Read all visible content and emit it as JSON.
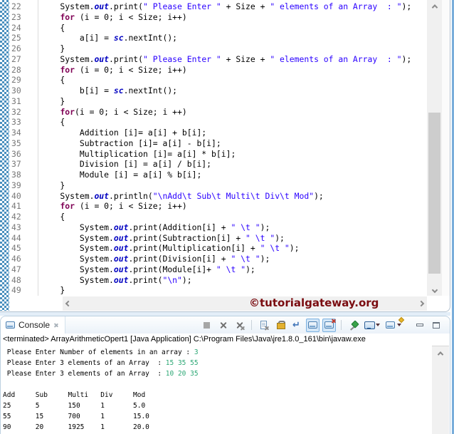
{
  "editor": {
    "line_numbers": [
      "22",
      "23",
      "24",
      "25",
      "26",
      "27",
      "28",
      "29",
      "30",
      "31",
      "32",
      "33",
      "34",
      "35",
      "36",
      "37",
      "38",
      "39",
      "40",
      "41",
      "42",
      "43",
      "44",
      "45",
      "46",
      "47",
      "48",
      "49"
    ],
    "code_lines": [
      {
        "segments": [
          {
            "t": "    System.",
            "c": "p"
          },
          {
            "t": "out",
            "c": "f"
          },
          {
            "t": ".print(",
            "c": "p"
          },
          {
            "t": "\" Please Enter \"",
            "c": "s"
          },
          {
            "t": " + Size + ",
            "c": "p"
          },
          {
            "t": "\" elements of an Array  : \"",
            "c": "s"
          },
          {
            "t": ");",
            "c": "p"
          }
        ]
      },
      {
        "segments": [
          {
            "t": "    ",
            "c": "p"
          },
          {
            "t": "for",
            "c": "k"
          },
          {
            "t": " (i = 0; i < Size; i++)",
            "c": "p"
          }
        ]
      },
      {
        "segments": [
          {
            "t": "    {",
            "c": "p"
          }
        ]
      },
      {
        "segments": [
          {
            "t": "        a[i] = ",
            "c": "p"
          },
          {
            "t": "sc",
            "c": "f"
          },
          {
            "t": ".nextInt();",
            "c": "p"
          }
        ]
      },
      {
        "segments": [
          {
            "t": "    }",
            "c": "p"
          }
        ]
      },
      {
        "segments": [
          {
            "t": "    System.",
            "c": "p"
          },
          {
            "t": "out",
            "c": "f"
          },
          {
            "t": ".print(",
            "c": "p"
          },
          {
            "t": "\" Please Enter \"",
            "c": "s"
          },
          {
            "t": " + Size + ",
            "c": "p"
          },
          {
            "t": "\" elements of an Array  : \"",
            "c": "s"
          },
          {
            "t": ");",
            "c": "p"
          }
        ]
      },
      {
        "segments": [
          {
            "t": "    ",
            "c": "p"
          },
          {
            "t": "for",
            "c": "k"
          },
          {
            "t": " (i = 0; i < Size; i++)",
            "c": "p"
          }
        ]
      },
      {
        "segments": [
          {
            "t": "    {",
            "c": "p"
          }
        ]
      },
      {
        "segments": [
          {
            "t": "        b[i] = ",
            "c": "p"
          },
          {
            "t": "sc",
            "c": "f"
          },
          {
            "t": ".nextInt();",
            "c": "p"
          }
        ]
      },
      {
        "segments": [
          {
            "t": "    }",
            "c": "p"
          }
        ]
      },
      {
        "segments": [
          {
            "t": "    ",
            "c": "p"
          },
          {
            "t": "for",
            "c": "k"
          },
          {
            "t": "(i = 0; i < Size; i ++)",
            "c": "p"
          }
        ]
      },
      {
        "segments": [
          {
            "t": "    {",
            "c": "p"
          }
        ]
      },
      {
        "segments": [
          {
            "t": "        Addition [i]= a[i] + b[i];",
            "c": "p"
          }
        ]
      },
      {
        "segments": [
          {
            "t": "        Subtraction [i]= a[i] - b[i];",
            "c": "p"
          }
        ]
      },
      {
        "segments": [
          {
            "t": "        Multiplication [i]= a[i] * b[i];",
            "c": "p"
          }
        ]
      },
      {
        "segments": [
          {
            "t": "        Division [i] = a[i] / b[i];",
            "c": "p"
          }
        ]
      },
      {
        "segments": [
          {
            "t": "        Module [i] = a[i] % b[i];",
            "c": "p"
          }
        ]
      },
      {
        "segments": [
          {
            "t": "    }",
            "c": "p"
          }
        ]
      },
      {
        "segments": [
          {
            "t": "    System.",
            "c": "p"
          },
          {
            "t": "out",
            "c": "f"
          },
          {
            "t": ".println(",
            "c": "p"
          },
          {
            "t": "\"\\nAdd\\t Sub\\t Multi\\t Div\\t Mod\"",
            "c": "s"
          },
          {
            "t": ");",
            "c": "p"
          }
        ]
      },
      {
        "segments": [
          {
            "t": "    ",
            "c": "p"
          },
          {
            "t": "for",
            "c": "k"
          },
          {
            "t": " (i = 0; i < Size; i++)",
            "c": "p"
          }
        ]
      },
      {
        "segments": [
          {
            "t": "    {",
            "c": "p"
          }
        ]
      },
      {
        "segments": [
          {
            "t": "        System.",
            "c": "p"
          },
          {
            "t": "out",
            "c": "f"
          },
          {
            "t": ".print(Addition[i] + ",
            "c": "p"
          },
          {
            "t": "\" \\t \"",
            "c": "s"
          },
          {
            "t": ");",
            "c": "p"
          }
        ]
      },
      {
        "segments": [
          {
            "t": "        System.",
            "c": "p"
          },
          {
            "t": "out",
            "c": "f"
          },
          {
            "t": ".print(Subtraction[i] + ",
            "c": "p"
          },
          {
            "t": "\" \\t \"",
            "c": "s"
          },
          {
            "t": ");",
            "c": "p"
          }
        ]
      },
      {
        "segments": [
          {
            "t": "        System.",
            "c": "p"
          },
          {
            "t": "out",
            "c": "f"
          },
          {
            "t": ".print(Multiplication[i] + ",
            "c": "p"
          },
          {
            "t": "\" \\t \"",
            "c": "s"
          },
          {
            "t": ");",
            "c": "p"
          }
        ]
      },
      {
        "segments": [
          {
            "t": "        System.",
            "c": "p"
          },
          {
            "t": "out",
            "c": "f"
          },
          {
            "t": ".print(Division[i] + ",
            "c": "p"
          },
          {
            "t": "\" \\t \"",
            "c": "s"
          },
          {
            "t": ");",
            "c": "p"
          }
        ]
      },
      {
        "segments": [
          {
            "t": "        System.",
            "c": "p"
          },
          {
            "t": "out",
            "c": "f"
          },
          {
            "t": ".print(Module[i]+ ",
            "c": "p"
          },
          {
            "t": "\" \\t \"",
            "c": "s"
          },
          {
            "t": ");",
            "c": "p"
          }
        ]
      },
      {
        "segments": [
          {
            "t": "        System.",
            "c": "p"
          },
          {
            "t": "out",
            "c": "f"
          },
          {
            "t": ".print(",
            "c": "p"
          },
          {
            "t": "\"\\n\"",
            "c": "s"
          },
          {
            "t": ");",
            "c": "p"
          }
        ]
      },
      {
        "segments": [
          {
            "t": "    }",
            "c": "p"
          }
        ]
      }
    ],
    "watermark": "©tutorialgateway.org",
    "colors": {
      "keyword": "#7f0055",
      "string": "#2a00ff",
      "field": "#0000c0",
      "plain": "#000000",
      "line_number": "#787878",
      "watermark": "#7a0c10"
    }
  },
  "console": {
    "tab_label": "Console",
    "status_line": "<terminated> ArrayArithmeticOpert1 [Java Application] C:\\Program Files\\Java\\jre1.8.0_161\\bin\\javaw.exe",
    "toolbar_icons": [
      {
        "name": "terminate-icon",
        "kind": "terminate"
      },
      {
        "name": "remove-launch-icon",
        "kind": "remove"
      },
      {
        "name": "remove-all-terminated-icon",
        "kind": "remove-all"
      },
      {
        "name": "clear-console-icon",
        "kind": "clear",
        "sep_before": true
      },
      {
        "name": "scroll-lock-icon",
        "kind": "lock"
      },
      {
        "name": "word-wrap-icon",
        "kind": "wrap"
      },
      {
        "name": "show-console-stdout-icon",
        "kind": "console-out",
        "active": true
      },
      {
        "name": "show-console-stderr-icon",
        "kind": "console-err",
        "active": true
      },
      {
        "name": "pin-console-icon",
        "kind": "pin",
        "sep_before": true
      },
      {
        "name": "display-selected-console-icon",
        "kind": "monitor",
        "dropdown": true
      },
      {
        "name": "open-console-icon",
        "kind": "new-console",
        "dropdown": true
      },
      {
        "name": "minimize-icon",
        "kind": "minimize",
        "gap_before": true
      },
      {
        "name": "maximize-icon",
        "kind": "maximize"
      }
    ],
    "output_lines": [
      {
        "segments": [
          {
            "t": " Please Enter Number of elements in an array : ",
            "c": "out"
          },
          {
            "t": "3",
            "c": "in"
          }
        ]
      },
      {
        "segments": [
          {
            "t": " Please Enter 3 elements of an Array  : ",
            "c": "out"
          },
          {
            "t": "15 35 55",
            "c": "in"
          }
        ]
      },
      {
        "segments": [
          {
            "t": " Please Enter 3 elements of an Array  : ",
            "c": "out"
          },
          {
            "t": "10 20 35",
            "c": "in"
          }
        ]
      },
      {
        "segments": [
          {
            "t": " ",
            "c": "out"
          }
        ]
      },
      {
        "segments": [
          {
            "t": "Add     Sub     Multi   Div     Mod",
            "c": "out"
          }
        ]
      },
      {
        "segments": [
          {
            "t": "25      5       150     1       5.0",
            "c": "out"
          }
        ]
      },
      {
        "segments": [
          {
            "t": "55      15      700     1       15.0",
            "c": "out"
          }
        ]
      },
      {
        "segments": [
          {
            "t": "90      20      1925    1       20.0",
            "c": "out"
          }
        ]
      }
    ],
    "colors": {
      "stdout": "#000000",
      "stdin": "#2ea876"
    }
  }
}
